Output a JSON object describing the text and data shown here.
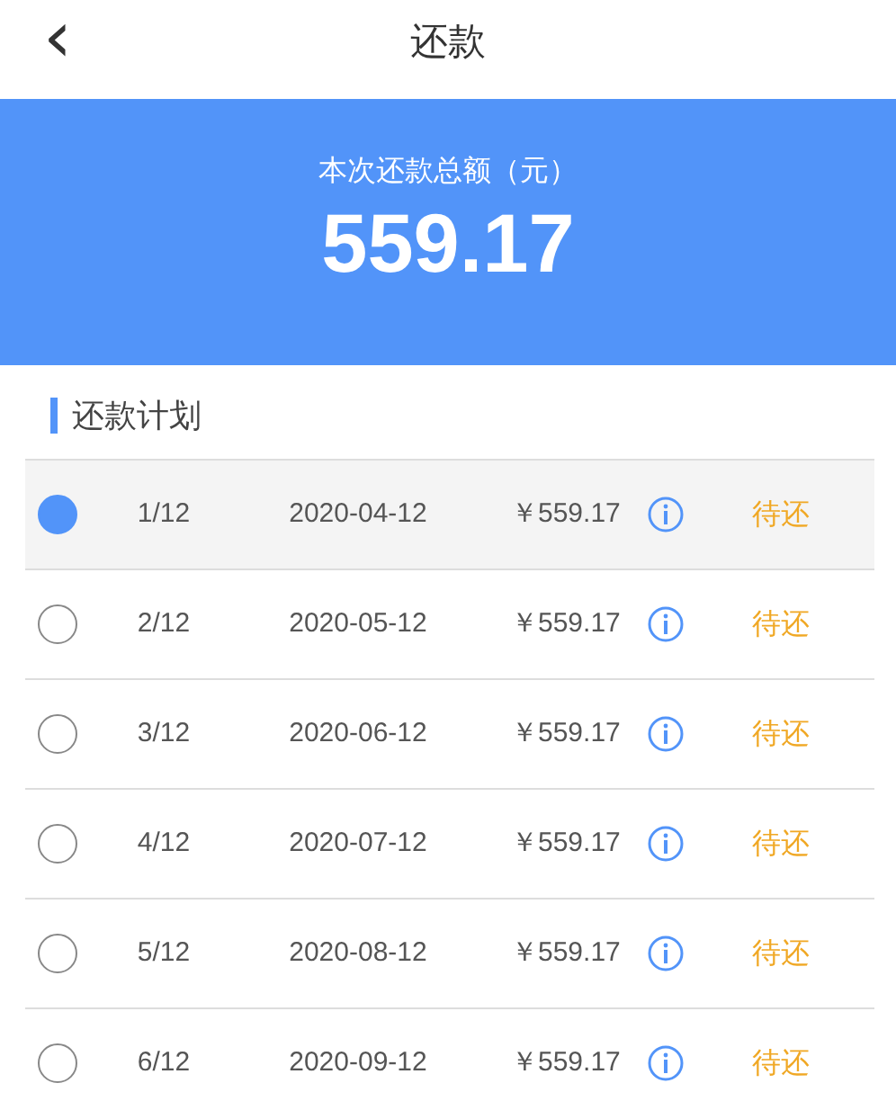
{
  "header": {
    "back": "‹",
    "title": "还款"
  },
  "summary": {
    "label": "本次还款总额（元）",
    "amount": "559.17"
  },
  "section_title": "还款计划",
  "plan": [
    {
      "selected": true,
      "period": "1/12",
      "date": "2020-04-12",
      "amount": "￥559.17",
      "status": "待还"
    },
    {
      "selected": false,
      "period": "2/12",
      "date": "2020-05-12",
      "amount": "￥559.17",
      "status": "待还"
    },
    {
      "selected": false,
      "period": "3/12",
      "date": "2020-06-12",
      "amount": "￥559.17",
      "status": "待还"
    },
    {
      "selected": false,
      "period": "4/12",
      "date": "2020-07-12",
      "amount": "￥559.17",
      "status": "待还"
    },
    {
      "selected": false,
      "period": "5/12",
      "date": "2020-08-12",
      "amount": "￥559.17",
      "status": "待还"
    },
    {
      "selected": false,
      "period": "6/12",
      "date": "2020-09-12",
      "amount": "￥559.17",
      "status": "待还"
    }
  ]
}
